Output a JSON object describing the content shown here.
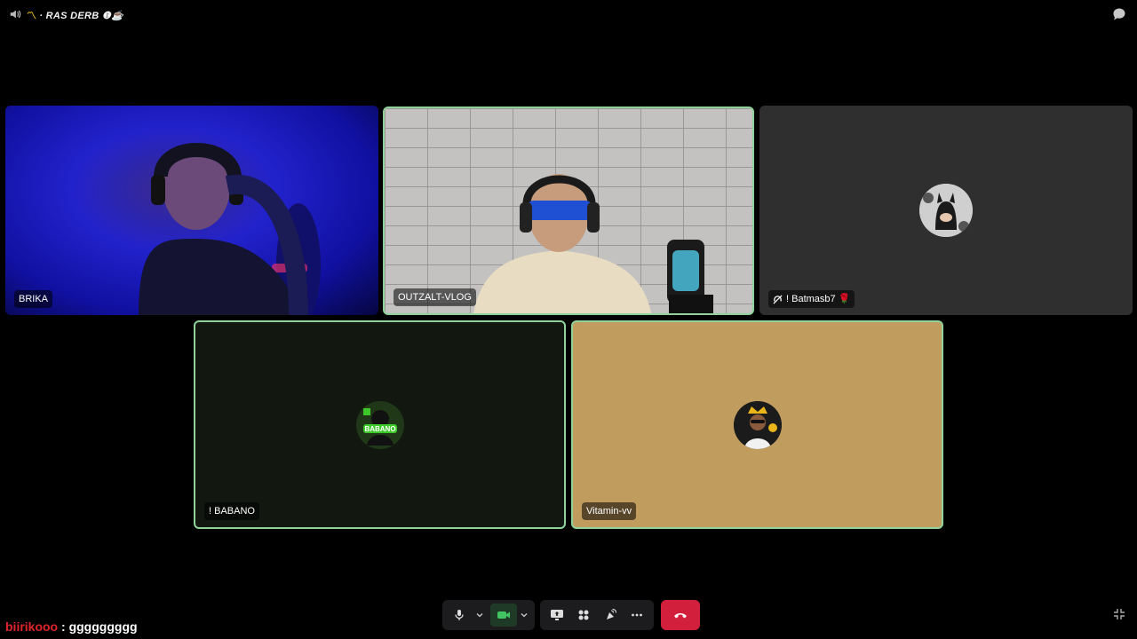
{
  "top_bar": {
    "channel_name": "· RAS DERB",
    "channel_suffix": "❶☕",
    "flag_glyph": "〽"
  },
  "participants": [
    {
      "name": "BRIKA",
      "speaking": false,
      "video": true
    },
    {
      "name": "OUTZALT-VLOG",
      "speaking": true,
      "video": true
    },
    {
      "name": "! Batmasb7 🌹",
      "speaking": false,
      "video": false,
      "avatar": "batman-avatar"
    },
    {
      "name": "! BABANO",
      "speaking": true,
      "video": false,
      "avatar": "babano-avatar"
    },
    {
      "name": "Vitamin-vv",
      "speaking": true,
      "video": false,
      "avatar": "vitamin-avatar"
    }
  ],
  "controls": {
    "mic_icon": "microphone-icon",
    "camera_icon": "camera-icon",
    "screen_share_icon": "screen-share-icon",
    "activities_icon": "activities-icon",
    "soundboard_icon": "soundboard-icon",
    "more_icon": "more-icon",
    "hangup_icon": "hangup-icon"
  },
  "chat_overlay": {
    "username": "biirikooo",
    "separator": " : ",
    "message": "ggggggggg"
  },
  "colors": {
    "speaking_border": "#8fd39b",
    "hangup": "#d21f3c",
    "chat_username": "#e0242c",
    "vitamin_tile_bg": "#c09c5e",
    "babano_tile_bg": "#121810"
  }
}
